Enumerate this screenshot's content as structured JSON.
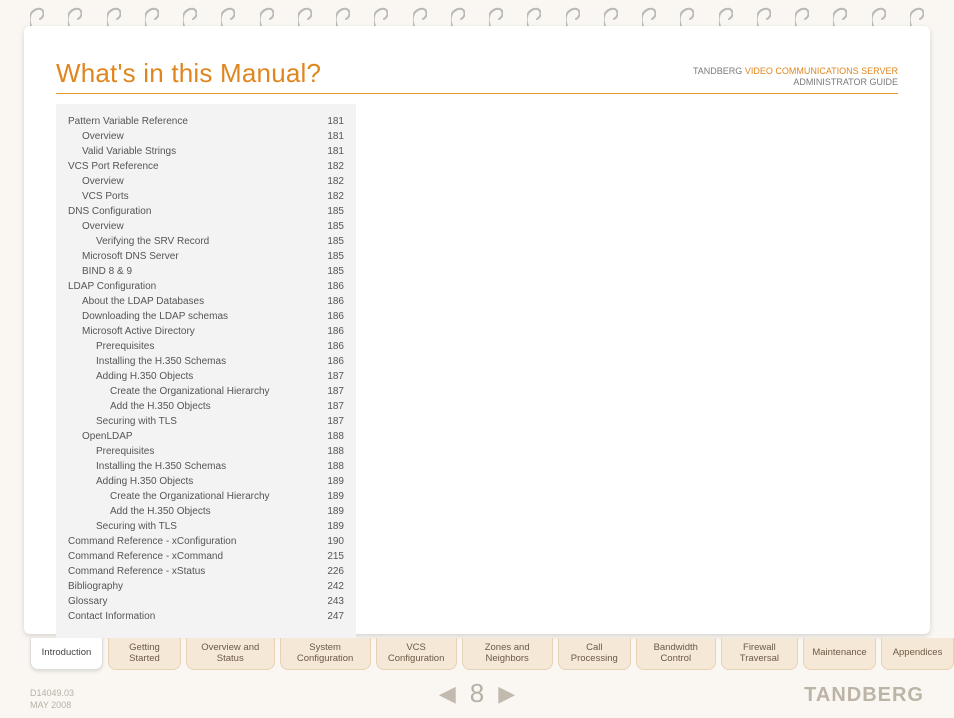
{
  "header": {
    "title": "What's in this Manual?",
    "brand": "TANDBERG",
    "product": "VIDEO COMMUNICATIONS SERVER",
    "subtitle": "ADMINISTRATOR GUIDE"
  },
  "toc": [
    {
      "label": "Pattern Variable Reference",
      "page": "181",
      "indent": 0
    },
    {
      "label": "Overview",
      "page": "181",
      "indent": 1
    },
    {
      "label": "Valid Variable Strings",
      "page": "181",
      "indent": 1
    },
    {
      "label": "VCS Port Reference",
      "page": "182",
      "indent": 0
    },
    {
      "label": "Overview",
      "page": "182",
      "indent": 1
    },
    {
      "label": "VCS Ports",
      "page": "182",
      "indent": 1
    },
    {
      "label": "DNS Configuration",
      "page": "185",
      "indent": 0
    },
    {
      "label": "Overview",
      "page": "185",
      "indent": 1
    },
    {
      "label": "Verifying the SRV Record",
      "page": "185",
      "indent": 2
    },
    {
      "label": "Microsoft DNS Server",
      "page": "185",
      "indent": 1
    },
    {
      "label": "BIND 8 & 9",
      "page": "185",
      "indent": 1
    },
    {
      "label": "LDAP Configuration",
      "page": "186",
      "indent": 0
    },
    {
      "label": "About the LDAP Databases",
      "page": "186",
      "indent": 1
    },
    {
      "label": "Downloading the LDAP schemas",
      "page": "186",
      "indent": 1
    },
    {
      "label": "Microsoft Active Directory",
      "page": "186",
      "indent": 1
    },
    {
      "label": "Prerequisites",
      "page": "186",
      "indent": 2
    },
    {
      "label": "Installing the H.350 Schemas",
      "page": "186",
      "indent": 2
    },
    {
      "label": "Adding H.350 Objects",
      "page": "187",
      "indent": 2
    },
    {
      "label": "Create the Organizational Hierarchy",
      "page": "187",
      "indent": 3
    },
    {
      "label": "Add the H.350 Objects",
      "page": "187",
      "indent": 3
    },
    {
      "label": "Securing with TLS",
      "page": "187",
      "indent": 2
    },
    {
      "label": "OpenLDAP",
      "page": "188",
      "indent": 1
    },
    {
      "label": "Prerequisites",
      "page": "188",
      "indent": 2
    },
    {
      "label": "Installing the H.350 Schemas",
      "page": "188",
      "indent": 2
    },
    {
      "label": "Adding H.350 Objects",
      "page": "189",
      "indent": 2
    },
    {
      "label": "Create the Organizational Hierarchy",
      "page": "189",
      "indent": 3
    },
    {
      "label": "Add the H.350 Objects",
      "page": "189",
      "indent": 3
    },
    {
      "label": "Securing with TLS",
      "page": "189",
      "indent": 2
    },
    {
      "label": "Command Reference - xConfiguration",
      "page": "190",
      "indent": 0
    },
    {
      "label": "Command Reference - xCommand",
      "page": "215",
      "indent": 0
    },
    {
      "label": "Command Reference - xStatus",
      "page": "226",
      "indent": 0
    },
    {
      "label": "Bibliography",
      "page": "242",
      "indent": 0
    },
    {
      "label": "Glossary",
      "page": "243",
      "indent": 0
    },
    {
      "label": "Contact Information",
      "page": "247",
      "indent": 0
    }
  ],
  "tabs": [
    {
      "label": "Introduction",
      "active": true
    },
    {
      "label": "Getting Started",
      "active": false
    },
    {
      "label": "Overview and Status",
      "active": false
    },
    {
      "label": "System Configuration",
      "active": false
    },
    {
      "label": "VCS Configuration",
      "active": false
    },
    {
      "label": "Zones and Neighbors",
      "active": false
    },
    {
      "label": "Call Processing",
      "active": false
    },
    {
      "label": "Bandwidth Control",
      "active": false
    },
    {
      "label": "Firewall Traversal",
      "active": false
    },
    {
      "label": "Maintenance",
      "active": false
    },
    {
      "label": "Appendices",
      "active": false
    }
  ],
  "footer": {
    "doc_id": "D14049.03",
    "date": "MAY 2008",
    "page_number": "8",
    "logo": "TANDBERG"
  },
  "spiral": {
    "count": 24
  }
}
